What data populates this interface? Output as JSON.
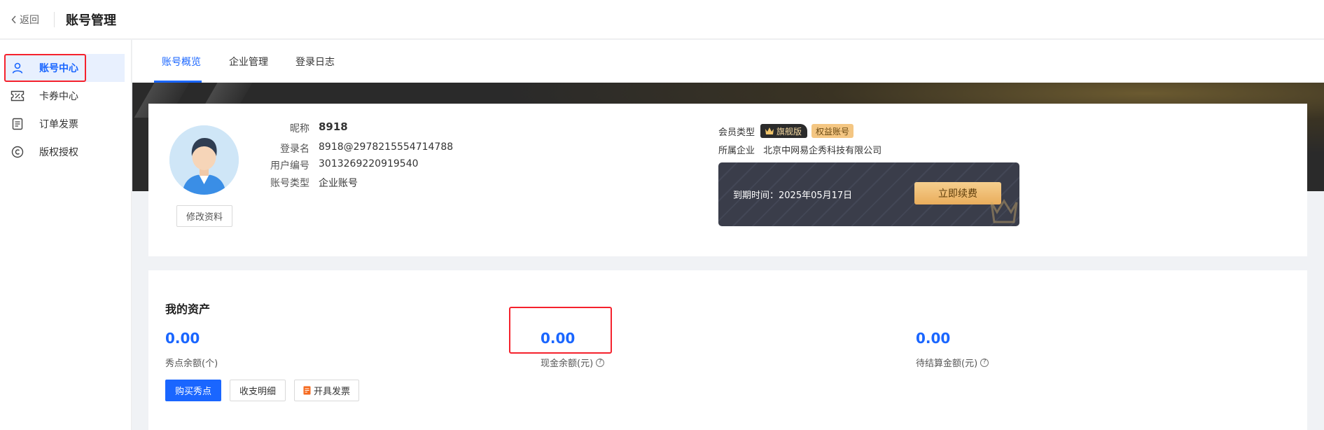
{
  "header": {
    "back_label": "返回",
    "title": "账号管理"
  },
  "sidebar": {
    "items": [
      {
        "label": "账号中心",
        "icon": "user-icon",
        "active": true
      },
      {
        "label": "卡券中心",
        "icon": "coupon-icon"
      },
      {
        "label": "订单发票",
        "icon": "document-icon"
      },
      {
        "label": "版权授权",
        "icon": "copyright-icon"
      }
    ]
  },
  "tabs": [
    {
      "label": "账号概览",
      "active": true
    },
    {
      "label": "企业管理"
    },
    {
      "label": "登录日志"
    }
  ],
  "profile": {
    "edit_label": "修改资料",
    "fields": [
      {
        "key": "昵称",
        "value": "8918"
      },
      {
        "key": "登录名",
        "value": "8918@2978215554714788"
      },
      {
        "key": "用户编号",
        "value": "3013269220919540"
      },
      {
        "key": "账号类型",
        "value": "企业账号"
      }
    ]
  },
  "membership": {
    "type_label": "会员类型",
    "flagship_badge": "旗舰版",
    "equity_badge": "权益账号",
    "company_label": "所属企业",
    "company": "北京中网易企秀科技有限公司",
    "expire_label": "到期时间：",
    "expire_date": "2025年05月17日",
    "renew_label": "立即续费"
  },
  "assets": {
    "title": "我的资产",
    "items": [
      {
        "amount": "0.00",
        "label": "秀点余额(个)"
      },
      {
        "amount": "0.00",
        "label": "现金余额(元)"
      },
      {
        "amount": "0.00",
        "label": "待结算金额(元)"
      }
    ],
    "buy_label": "购买秀点",
    "detail_label": "收支明细",
    "invoice_label": "开具发票"
  },
  "colors": {
    "accent": "#1a66ff",
    "highlight": "#f5222d",
    "gold": "#e9ad5c"
  }
}
